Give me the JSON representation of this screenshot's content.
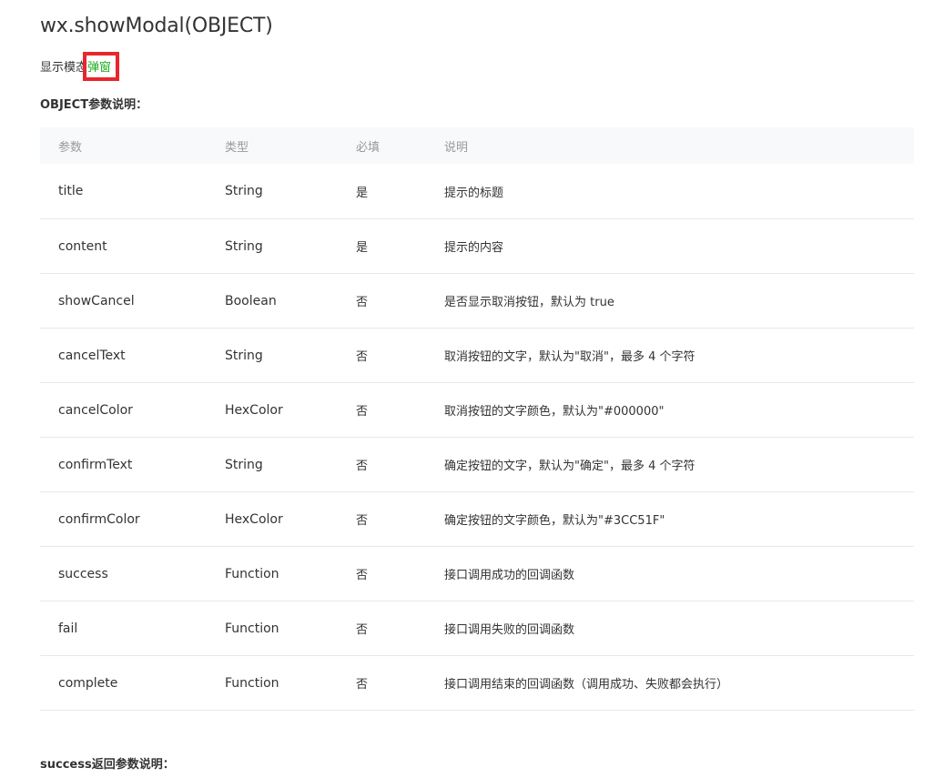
{
  "doc": {
    "title": "wx.showModal(OBJECT)",
    "description_prefix": "显示模态",
    "description_highlight": "弹窗",
    "object_heading": "OBJECT参数说明：",
    "success_heading": "success返回参数说明："
  },
  "table": {
    "headers": [
      "参数",
      "类型",
      "必填",
      "说明"
    ],
    "rows": [
      {
        "param": "title",
        "type": "String",
        "required": "是",
        "desc": "提示的标题"
      },
      {
        "param": "content",
        "type": "String",
        "required": "是",
        "desc": "提示的内容"
      },
      {
        "param": "showCancel",
        "type": "Boolean",
        "required": "否",
        "desc": "是否显示取消按钮，默认为 true"
      },
      {
        "param": "cancelText",
        "type": "String",
        "required": "否",
        "desc": "取消按钮的文字，默认为\"取消\"，最多 4 个字符"
      },
      {
        "param": "cancelColor",
        "type": "HexColor",
        "required": "否",
        "desc": "取消按钮的文字颜色，默认为\"#000000\""
      },
      {
        "param": "confirmText",
        "type": "String",
        "required": "否",
        "desc": "确定按钮的文字，默认为\"确定\"，最多 4 个字符"
      },
      {
        "param": "confirmColor",
        "type": "HexColor",
        "required": "否",
        "desc": "确定按钮的文字颜色，默认为\"#3CC51F\""
      },
      {
        "param": "success",
        "type": "Function",
        "required": "否",
        "desc": "接口调用成功的回调函数"
      },
      {
        "param": "fail",
        "type": "Function",
        "required": "否",
        "desc": "接口调用失败的回调函数"
      },
      {
        "param": "complete",
        "type": "Function",
        "required": "否",
        "desc": "接口调用结束的回调函数（调用成功、失败都会执行）"
      }
    ]
  },
  "colors": {
    "highlight_text": "#1aad19",
    "annotation_box": "#e8262d",
    "header_bg": "#f8f9fa"
  }
}
